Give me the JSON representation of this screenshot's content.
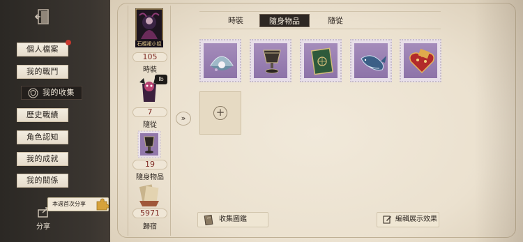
{
  "sidebar": {
    "items": [
      {
        "label": "個人檔案"
      },
      {
        "label": "我的戰鬥"
      },
      {
        "label": "我的收集"
      },
      {
        "label": "歷史戰績"
      },
      {
        "label": "角色認知"
      },
      {
        "label": "我的成就"
      },
      {
        "label": "我的關係"
      }
    ],
    "active_index": 2,
    "share_label": "分享",
    "share_tip": "本週首次分享"
  },
  "stats": {
    "costume_card_label": "石榴裙小姐",
    "pet_badge": "Ib",
    "costume": {
      "value": "105",
      "label": "時裝"
    },
    "pet": {
      "value": "7",
      "label": "隨從"
    },
    "accessory": {
      "value": "19",
      "label": "隨身物品"
    },
    "homecoming": {
      "value": "5971",
      "label": "歸宿"
    }
  },
  "arrow": "»",
  "tabs": [
    {
      "label": "時裝"
    },
    {
      "label": "隨身物品"
    },
    {
      "label": "隨從"
    }
  ],
  "active_tab": 1,
  "items": [
    {
      "icon": "pearl-shell-icon"
    },
    {
      "icon": "goblet-icon"
    },
    {
      "icon": "green-book-icon"
    },
    {
      "icon": "whale-icon"
    },
    {
      "icon": "heart-box-icon"
    }
  ],
  "add_symbol": "+",
  "buttons": {
    "collection_album": "收集圖鑑",
    "edit_display": "編輯展示效果"
  },
  "colors": {
    "accent_red": "#7e2a23",
    "stamp_purple": "#9a80b3",
    "parchment": "#ede3d1",
    "dark": "#2d2723"
  }
}
